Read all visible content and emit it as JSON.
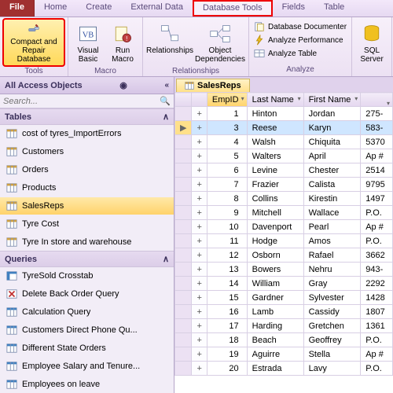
{
  "tabs": {
    "file": "File",
    "home": "Home",
    "create": "Create",
    "external": "External Data",
    "dbtools": "Database Tools",
    "fields": "Fields",
    "table": "Table"
  },
  "ribbon": {
    "tools": {
      "compact": "Compact and Repair Database",
      "group": "Tools"
    },
    "macro": {
      "vb": "Visual Basic",
      "run": "Run Macro",
      "group": "Macro"
    },
    "relationships": {
      "rel": "Relationships",
      "obj": "Object Dependencies",
      "group": "Relationships"
    },
    "analyze": {
      "doc": "Database Documenter",
      "perf": "Analyze Performance",
      "tbl": "Analyze Table",
      "group": "Analyze"
    },
    "sql": "SQL Server"
  },
  "nav": {
    "title": "All Access Objects",
    "search": "Search...",
    "tables_head": "Tables",
    "queries_head": "Queries",
    "tables": [
      "cost of tyres_ImportErrors",
      "Customers",
      "Orders",
      "Products",
      "SalesReps",
      "Tyre Cost",
      "Tyre In store and warehouse"
    ],
    "queries": [
      "TyreSold Crosstab",
      "Delete Back Order Query",
      "Calculation Query",
      "Customers Direct Phone Qu...",
      "Different State Orders",
      "Employee Salary and Tenure...",
      "Employees on leave"
    ]
  },
  "datasheet": {
    "tab": "SalesReps",
    "columns": [
      "EmpID",
      "Last Name",
      "First Name",
      ""
    ],
    "rows": [
      {
        "id": "1",
        "ln": "Hinton",
        "fn": "Jordan",
        "ext": "275-"
      },
      {
        "id": "3",
        "ln": "Reese",
        "fn": "Karyn",
        "ext": "583-",
        "selected": true
      },
      {
        "id": "4",
        "ln": "Walsh",
        "fn": "Chiquita",
        "ext": "5370"
      },
      {
        "id": "5",
        "ln": "Walters",
        "fn": "April",
        "ext": "Ap #"
      },
      {
        "id": "6",
        "ln": "Levine",
        "fn": "Chester",
        "ext": "2514"
      },
      {
        "id": "7",
        "ln": "Frazier",
        "fn": "Calista",
        "ext": "9795"
      },
      {
        "id": "8",
        "ln": "Collins",
        "fn": "Kirestin",
        "ext": "1497"
      },
      {
        "id": "9",
        "ln": "Mitchell",
        "fn": "Wallace",
        "ext": "P.O."
      },
      {
        "id": "10",
        "ln": "Davenport",
        "fn": "Pearl",
        "ext": "Ap #"
      },
      {
        "id": "11",
        "ln": "Hodge",
        "fn": "Amos",
        "ext": "P.O."
      },
      {
        "id": "12",
        "ln": "Osborn",
        "fn": "Rafael",
        "ext": "3662"
      },
      {
        "id": "13",
        "ln": "Bowers",
        "fn": "Nehru",
        "ext": "943-"
      },
      {
        "id": "14",
        "ln": "William",
        "fn": "Gray",
        "ext": "2292"
      },
      {
        "id": "15",
        "ln": "Gardner",
        "fn": "Sylvester",
        "ext": "1428"
      },
      {
        "id": "16",
        "ln": "Lamb",
        "fn": "Cassidy",
        "ext": "1807"
      },
      {
        "id": "17",
        "ln": "Harding",
        "fn": "Gretchen",
        "ext": "1361"
      },
      {
        "id": "18",
        "ln": "Beach",
        "fn": "Geoffrey",
        "ext": "P.O."
      },
      {
        "id": "19",
        "ln": "Aguirre",
        "fn": "Stella",
        "ext": "Ap #"
      },
      {
        "id": "20",
        "ln": "Estrada",
        "fn": "Lavy",
        "ext": "P.O."
      }
    ]
  }
}
